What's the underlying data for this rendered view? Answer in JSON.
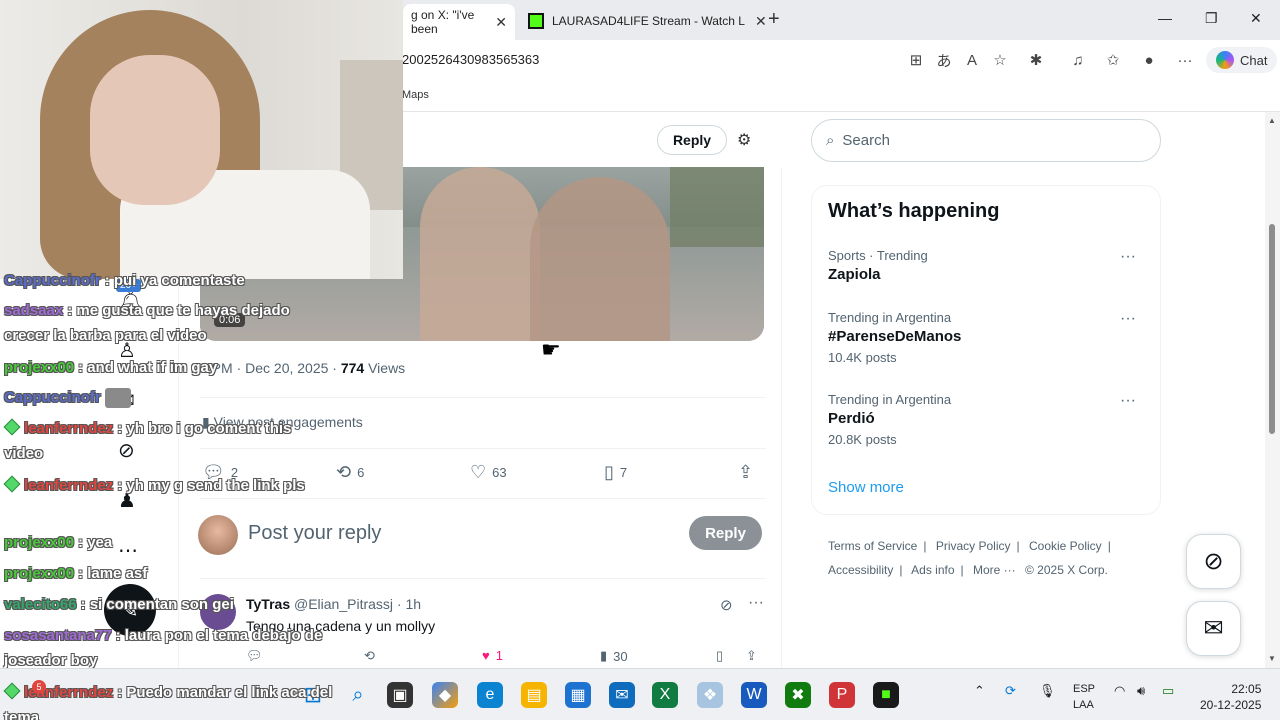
{
  "browser": {
    "tabs": [
      {
        "label": "g on X: \"i've been"
      },
      {
        "label": "LAURASAD4LIFE Stream - Watch L"
      }
    ],
    "url": "2002526430983565363",
    "bookmark": "Maps",
    "copilot_label": "Chat"
  },
  "post": {
    "reply_pill": "Reply",
    "video_time": "0:06",
    "meta_time": "3 PM · Dec 20, 2025 · ",
    "views_count": "774",
    "views_label": "Views",
    "engagements_label": "View post engagements",
    "actions": {
      "replies": "2",
      "reposts": "6",
      "likes": "63",
      "bookmarks": "7"
    }
  },
  "composer": {
    "placeholder": "Post your reply",
    "button": "Reply"
  },
  "reply": {
    "name": "TyTras",
    "handle": "@Elian_Pitrassj · 1h",
    "text": "Tengo una cadena y un mollyy",
    "likes": "1",
    "views": "30"
  },
  "sidebar": {
    "search_placeholder": "Search",
    "trends_title": "What’s happening",
    "trends": [
      {
        "category": "Sports · Trending",
        "name": "Zapiola",
        "posts": ""
      },
      {
        "category": "Trending in Argentina",
        "name": "#ParenseDeManos",
        "posts": "10.4K posts"
      },
      {
        "category": "Trending in Argentina",
        "name": "Perdió",
        "posts": "20.8K posts"
      }
    ],
    "show_more": "Show more",
    "footer": [
      "Terms of Service",
      "|",
      "Privacy Policy",
      "|",
      "Cookie Policy",
      "|",
      "Accessibility",
      "|",
      "Ads info",
      "|",
      "More ···",
      "© 2025 X Corp."
    ]
  },
  "chat": [
    {
      "user": "Cappuccinofr",
      "msg": ": pui ya comentaste",
      "color": "#5b6cc9",
      "badge": false
    },
    {
      "user": "sadsaax",
      "msg": ": me gusta que te hayas dejado crecer la barba para el video",
      "color": "#a06ad6",
      "badge": false
    },
    {
      "user": "projexx00",
      "msg": ": and what if im gay",
      "color": "#49c93a",
      "badge": false
    },
    {
      "user": "Cappuccinofr",
      "msg": "",
      "color": "#5b6cc9",
      "badge": false
    },
    {
      "user": "leanferrndez",
      "msg": ": yh bro i go coment this video",
      "color": "#e0463f",
      "badge": true
    },
    {
      "user": "leanferrndez",
      "msg": ": yh my g send the link pls",
      "color": "#e0463f",
      "badge": true
    },
    {
      "user": "projexx00",
      "msg": ": yea",
      "color": "#49c93a",
      "badge": false
    },
    {
      "user": "projexx00",
      "msg": ": lame asf",
      "color": "#49c93a",
      "badge": false
    },
    {
      "user": "valecito66",
      "msg": ": si comentan son gei",
      "color": "#34a86a",
      "badge": false
    },
    {
      "user": "sosasantana77",
      "msg": ": laura pon el tema debajo de joseador boy",
      "color": "#a06ad6",
      "badge": false
    },
    {
      "user": "leanferrndez",
      "msg": ": Puedo mandar el link aca del tema",
      "color": "#e0463f",
      "badge": true
    }
  ],
  "overlay_badge": "20+",
  "taskbar": {
    "lang_top": "ESP",
    "lang_bottom": "LAA",
    "time": "22:05",
    "date": "20-12-2025",
    "notification_count": "5"
  }
}
